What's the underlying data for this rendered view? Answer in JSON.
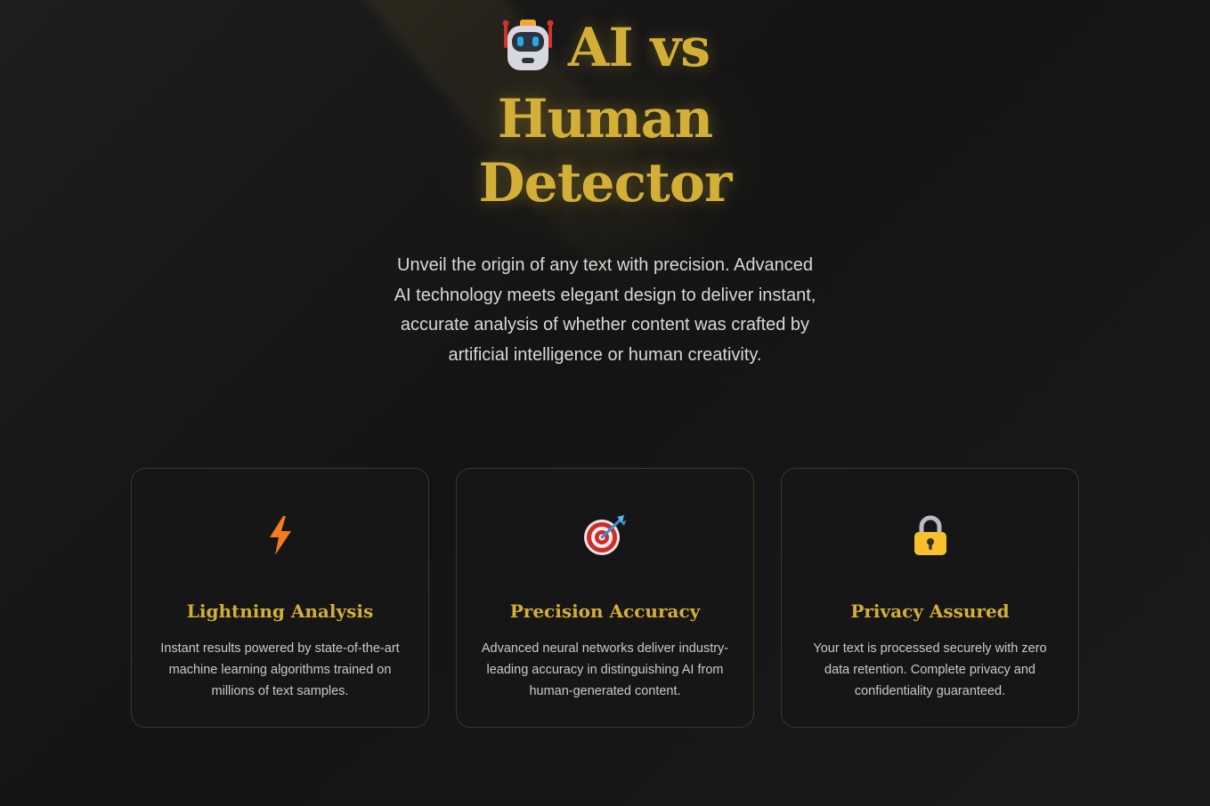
{
  "hero": {
    "title": "AI vs Human Detector",
    "title_icon": "robot-icon",
    "subtitle": "Unveil the origin of any text with precision. Advanced AI technology meets elegant design to deliver instant, accurate analysis of whether content was crafted by artificial intelligence or human creativity."
  },
  "features": [
    {
      "icon": "lightning-icon",
      "title": "Lightning Analysis",
      "text": "Instant results powered by state-of-the-art machine learning algorithms trained on millions of text samples."
    },
    {
      "icon": "target-icon",
      "title": "Precision Accuracy",
      "text": "Advanced neural networks deliver industry-leading accuracy in distinguishing AI from human-generated content."
    },
    {
      "icon": "lock-icon",
      "title": "Privacy Assured",
      "text": "Your text is processed securely with zero data retention. Complete privacy and confidentiality guaranteed."
    }
  ],
  "colors": {
    "accent": "#d4af37",
    "background": "#151515",
    "text": "#d8d8d8"
  }
}
